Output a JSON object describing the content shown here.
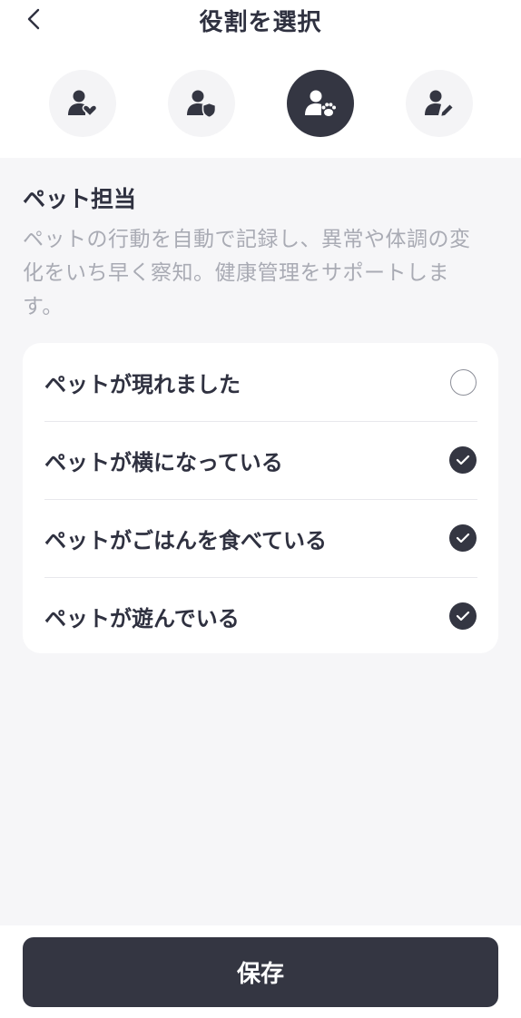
{
  "header": {
    "title": "役割を選択",
    "back_icon": "chevron-left-icon"
  },
  "roles": [
    {
      "icon": "user-heart-icon",
      "selected": false
    },
    {
      "icon": "user-shield-icon",
      "selected": false
    },
    {
      "icon": "user-paw-icon",
      "selected": true
    },
    {
      "icon": "user-edit-icon",
      "selected": false
    }
  ],
  "role_detail": {
    "name": "ペット担当",
    "description_lines": [
      "ペットの行動を自動で記録し、異常や体調の変",
      "化をいち早く察知。健康管理をサポートしま",
      "す。"
    ]
  },
  "options": [
    {
      "label": "ペットが現れました",
      "checked": false
    },
    {
      "label": "ペットが横になっている",
      "checked": true
    },
    {
      "label": "ペットがごはんを食べている",
      "checked": true
    },
    {
      "label": "ペットが遊んでいる",
      "checked": true
    }
  ],
  "footer": {
    "save_label": "保存"
  },
  "colors": {
    "primary_dark": "#343642",
    "text": "#2f3140",
    "muted_text": "#a9abb4",
    "background": "#f6f6f8",
    "surface": "#ffffff"
  }
}
